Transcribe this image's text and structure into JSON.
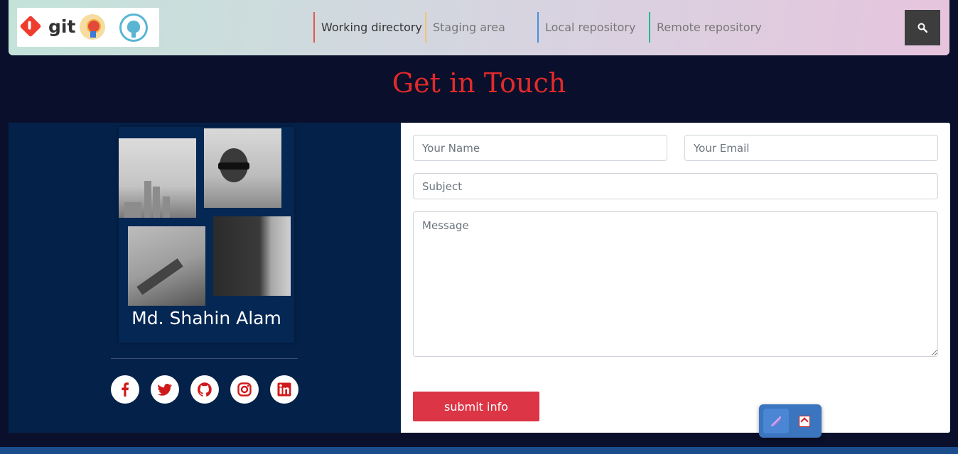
{
  "navbar": {
    "logo_text": "git",
    "items": [
      {
        "label": "Working directory",
        "color": "#e5584d"
      },
      {
        "label": "Staging area",
        "color": "#f0c277"
      },
      {
        "label": "Local repository",
        "color": "#4a90d9"
      },
      {
        "label": "Remote repository",
        "color": "#2ab59a"
      }
    ],
    "search_icon": "search-icon"
  },
  "heading": "Get in Touch",
  "profile": {
    "name": "Md. Shahin Alam",
    "social": [
      {
        "icon": "facebook-icon"
      },
      {
        "icon": "twitter-icon"
      },
      {
        "icon": "github-icon"
      },
      {
        "icon": "instagram-icon"
      },
      {
        "icon": "linkedin-icon"
      }
    ]
  },
  "form": {
    "name_placeholder": "Your Name",
    "email_placeholder": "Your Email",
    "subject_placeholder": "Subject",
    "message_placeholder": "Message",
    "submit_label": "submit info"
  },
  "colors": {
    "background": "#0a102b",
    "panel": "#04214a",
    "accent_red": "#e42a2a",
    "submit": "#dc3545"
  }
}
